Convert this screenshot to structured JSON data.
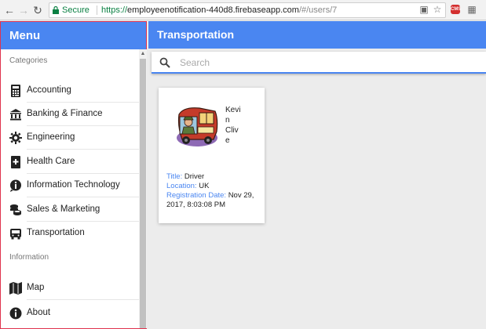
{
  "browser": {
    "secure_label": "Secure",
    "url_prefix": "https://",
    "url_host": "employeenotification-440d8.firebaseapp.com",
    "url_path": "/#/users/7",
    "ext_badge": "CMS"
  },
  "sidebar": {
    "title": "Menu",
    "categories_label": "Categories",
    "information_label": "Information",
    "categories": [
      {
        "label": "Accounting",
        "icon": "calculator-icon"
      },
      {
        "label": "Banking & Finance",
        "icon": "bank-icon"
      },
      {
        "label": "Engineering",
        "icon": "gear-icon"
      },
      {
        "label": "Health Care",
        "icon": "medical-book-icon"
      },
      {
        "label": "Information Technology",
        "icon": "info-chat-icon"
      },
      {
        "label": "Sales & Marketing",
        "icon": "coins-icon"
      },
      {
        "label": "Transportation",
        "icon": "bus-icon"
      }
    ],
    "information": [
      {
        "label": "Map",
        "icon": "map-icon"
      },
      {
        "label": "About",
        "icon": "info-icon"
      }
    ]
  },
  "header": {
    "title": "Transportation"
  },
  "search": {
    "placeholder": "Search",
    "value": ""
  },
  "employee": {
    "first_name": "Kevin",
    "first_name_l1": "Kevi",
    "first_name_l2": "n",
    "last_name_l1": "Cliv",
    "last_name_l2": "e",
    "title_key": "Title:",
    "title_value": "Driver",
    "location_key": "Location:",
    "location_value": "UK",
    "reg_key": "Registration Date:",
    "reg_value": "Nov 29, 2017, 8:03:08 PM"
  },
  "colors": {
    "accent": "#4a86f1",
    "sidebar_border": "#e0334e"
  }
}
